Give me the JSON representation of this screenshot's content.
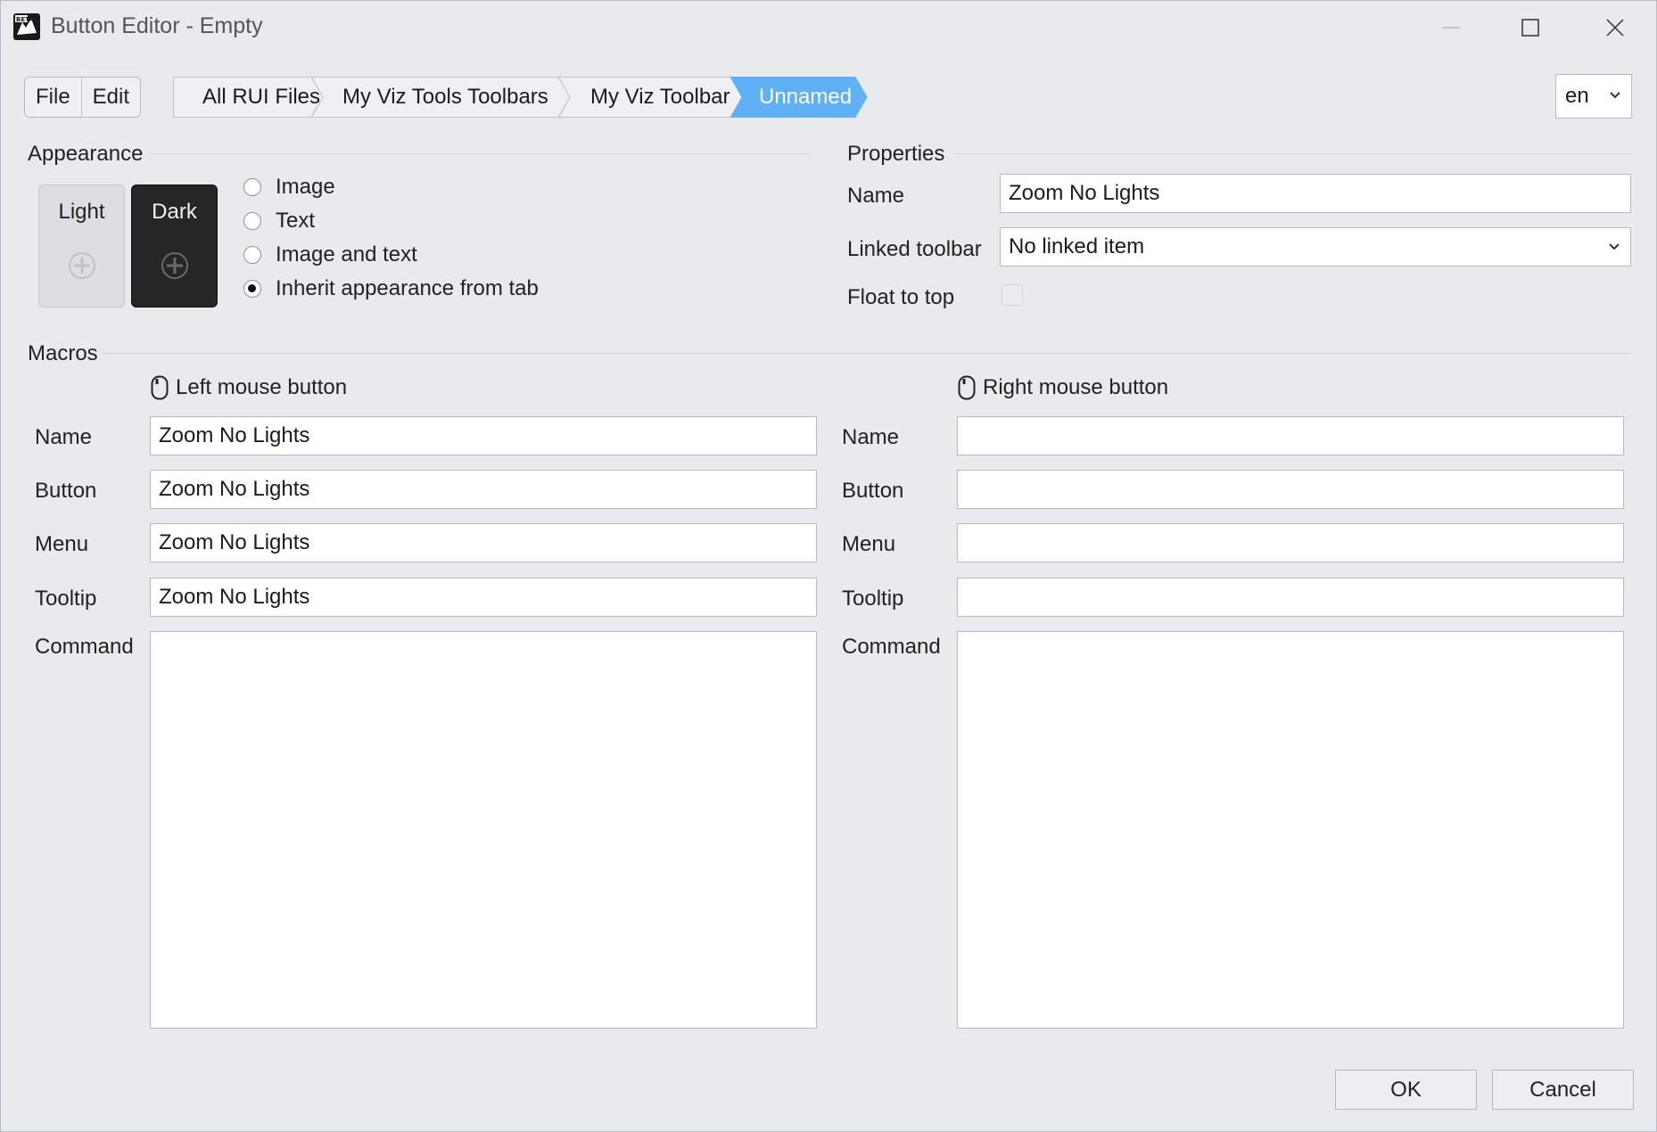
{
  "window": {
    "title": "Button Editor - Empty",
    "app_icon": "rhino-beta-icon"
  },
  "menu": [
    "File",
    "Edit"
  ],
  "breadcrumb": [
    "All RUI Files",
    "My Viz Tools Toolbars",
    "My Viz Toolbar",
    "Unnamed"
  ],
  "language": {
    "value": "en"
  },
  "appearance": {
    "title": "Appearance",
    "light_label": "Light",
    "dark_label": "Dark",
    "options": [
      "Image",
      "Text",
      "Image and text",
      "Inherit appearance from tab"
    ],
    "selected": "Inherit appearance from tab"
  },
  "properties": {
    "title": "Properties",
    "name_label": "Name",
    "name_value": "Zoom No Lights",
    "linked_label": "Linked toolbar",
    "linked_value": "No linked item",
    "float_label": "Float to top",
    "float_checked": false
  },
  "macros": {
    "title": "Macros",
    "left": {
      "heading": "Left mouse button",
      "name_label": "Name",
      "name": "Zoom No Lights",
      "button_label": "Button",
      "button": "Zoom No Lights",
      "menu_label": "Menu",
      "menu": "Zoom No Lights",
      "tooltip_label": "Tooltip",
      "tooltip": "Zoom No Lights",
      "command_label": "Command",
      "command": ""
    },
    "right": {
      "heading": "Right mouse button",
      "name_label": "Name",
      "name": "",
      "button_label": "Button",
      "button": "",
      "menu_label": "Menu",
      "menu": "",
      "tooltip_label": "Tooltip",
      "tooltip": "",
      "command_label": "Command",
      "command": ""
    }
  },
  "buttons": {
    "ok": "OK",
    "cancel": "Cancel"
  },
  "colors": {
    "accent": "#5fb0f5",
    "window_bg": "#e9eaee"
  }
}
